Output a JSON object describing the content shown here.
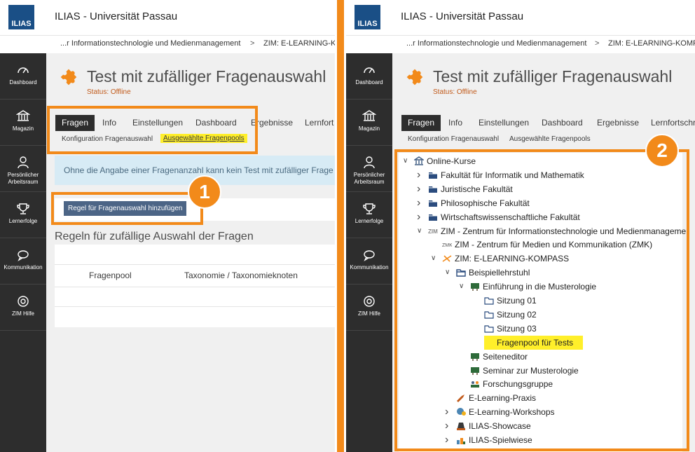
{
  "site_title": "ILIAS - Universität Passau",
  "logo_text": "ILIAS",
  "breadcrumbs": [
    "...r Informationstechnologie und Medienmanagement",
    "ZIM: E-LEARNING-KOMPASS"
  ],
  "breadcrumb_left_second": "ZIM: E-LEARNING-KOMP",
  "sidebar": [
    {
      "label": "Dashboard",
      "icon": "dashboard-icon"
    },
    {
      "label": "Magazin",
      "icon": "repository-icon"
    },
    {
      "label": "Persönlicher Arbeitsraum",
      "icon": "personal-workspace-icon"
    },
    {
      "label": "Lernerfolge",
      "icon": "trophy-icon"
    },
    {
      "label": "Kommunikation",
      "icon": "chat-icon"
    },
    {
      "label": "ZIM Hilfe",
      "icon": "help-icon"
    }
  ],
  "page": {
    "title": "Test mit zufälliger Fragenauswahl",
    "status": "Status: Offline"
  },
  "tabs": [
    "Fragen",
    "Info",
    "Einstellungen",
    "Dashboard",
    "Ergebnisse",
    "Lernfortschritt"
  ],
  "tabs_left_last": "Lernfort",
  "tabs_right_last": "Lernfortschr",
  "subtabs": [
    "Konfiguration Fragenauswahl",
    "Ausgewählte Fragenpools"
  ],
  "info_message": "Ohne die Angabe einer Fragenanzahl kann kein Test mit zufälliger Frage",
  "add_rule_button": "Regel für Fragenauswahl hinzufügen",
  "rules_title": "Regeln für zufällige Auswahl der Fragen",
  "table_headers": [
    "Fragenpool",
    "Taxonomie / Taxonomieknoten"
  ],
  "badges": [
    "1",
    "2"
  ],
  "tree": [
    {
      "label": "Online-Kurse",
      "chev": "down",
      "icon": "bank-icon"
    },
    {
      "label": "Fakultät für Informatik und Mathematik",
      "chev": "right",
      "icon": "folder-icon"
    },
    {
      "label": "Juristische Fakultät",
      "chev": "right",
      "icon": "folder-icon"
    },
    {
      "label": "Philosophische Fakultät",
      "chev": "right",
      "icon": "folder-icon"
    },
    {
      "label": "Wirtschaftswissenschaftliche Fakultät",
      "chev": "right",
      "icon": "folder-icon"
    },
    {
      "label": "ZIM - Zentrum für Informationstechnologie und Medienmanageme",
      "chev": "down",
      "icon": "zim-icon"
    },
    {
      "label": "ZIM - Zentrum für Medien und Kommunikation (ZMK)",
      "chev": "",
      "icon": "zmk-icon"
    },
    {
      "label": "ZIM: E-LEARNING-KOMPASS",
      "chev": "down",
      "icon": "compass-icon"
    },
    {
      "label": "Beispiellehrstuhl",
      "chev": "down",
      "icon": "folder-open-icon"
    },
    {
      "label": "Einführung in die Musterologie",
      "chev": "down",
      "icon": "course-icon"
    },
    {
      "label": "Sitzung 01",
      "chev": "",
      "icon": "folder-outline-icon"
    },
    {
      "label": "Sitzung 02",
      "chev": "",
      "icon": "folder-outline-icon"
    },
    {
      "label": "Sitzung 03",
      "chev": "",
      "icon": "folder-outline-icon"
    },
    {
      "label": "Fragenpool für Tests",
      "chev": "",
      "icon": "question-pool-icon"
    },
    {
      "label": "Seiteneditor",
      "chev": "",
      "icon": "course-icon"
    },
    {
      "label": "Seminar zur Musterologie",
      "chev": "",
      "icon": "course-icon"
    },
    {
      "label": "Forschungsgruppe",
      "chev": "",
      "icon": "group-icon"
    },
    {
      "label": "E-Learning-Praxis",
      "chev": "",
      "icon": "praxis-icon"
    },
    {
      "label": "E-Learning-Workshops",
      "chev": "right",
      "icon": "workshop-icon"
    },
    {
      "label": "ILIAS-Showcase",
      "chev": "right",
      "icon": "showcase-icon"
    },
    {
      "label": "ILIAS-Spielwiese",
      "chev": "right",
      "icon": "playground-icon"
    }
  ],
  "colors": {
    "accent": "#f28a1a",
    "highlight": "#ffef2a",
    "sidebar": "#2d2d2d",
    "status": "#c15a1a",
    "button": "#4c6586"
  }
}
